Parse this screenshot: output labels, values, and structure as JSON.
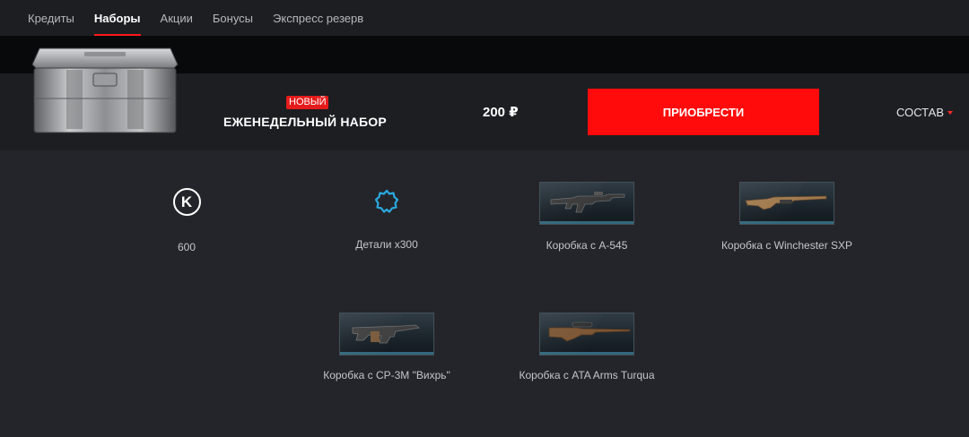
{
  "nav": {
    "items": [
      {
        "label": "Кредиты",
        "active": false
      },
      {
        "label": "Наборы",
        "active": true
      },
      {
        "label": "Акции",
        "active": false
      },
      {
        "label": "Бонусы",
        "active": false
      },
      {
        "label": "Экспресс резерв",
        "active": false
      }
    ]
  },
  "offer": {
    "badge": "НОВЫЙ",
    "title": "ЕЖЕНЕДЕЛЬНЫЙ НАБОР",
    "price": "200 ₽",
    "buy_label": "ПРИОБРЕСТИ",
    "contents_label": "СОСТАВ"
  },
  "items": [
    {
      "label": "600",
      "icon": "credits-icon"
    },
    {
      "label": "Детали x300",
      "icon": "parts-gear-icon"
    },
    {
      "label": "Коробка с А-545",
      "icon": "rifle-box-icon"
    },
    {
      "label": "Коробка с Winchester SXP",
      "icon": "shotgun-box-icon"
    },
    {
      "label": "Коробка с СР-3М \"Вихрь\"",
      "icon": "smg-box-icon"
    },
    {
      "label": "Коробка с ATA Arms Turqua",
      "icon": "sniper-box-icon"
    }
  ],
  "colors": {
    "accent": "#ff0b0b",
    "nav_bg": "#1d1e22",
    "panel_bg": "#24252a",
    "parts_icon": "#29a9e0"
  }
}
